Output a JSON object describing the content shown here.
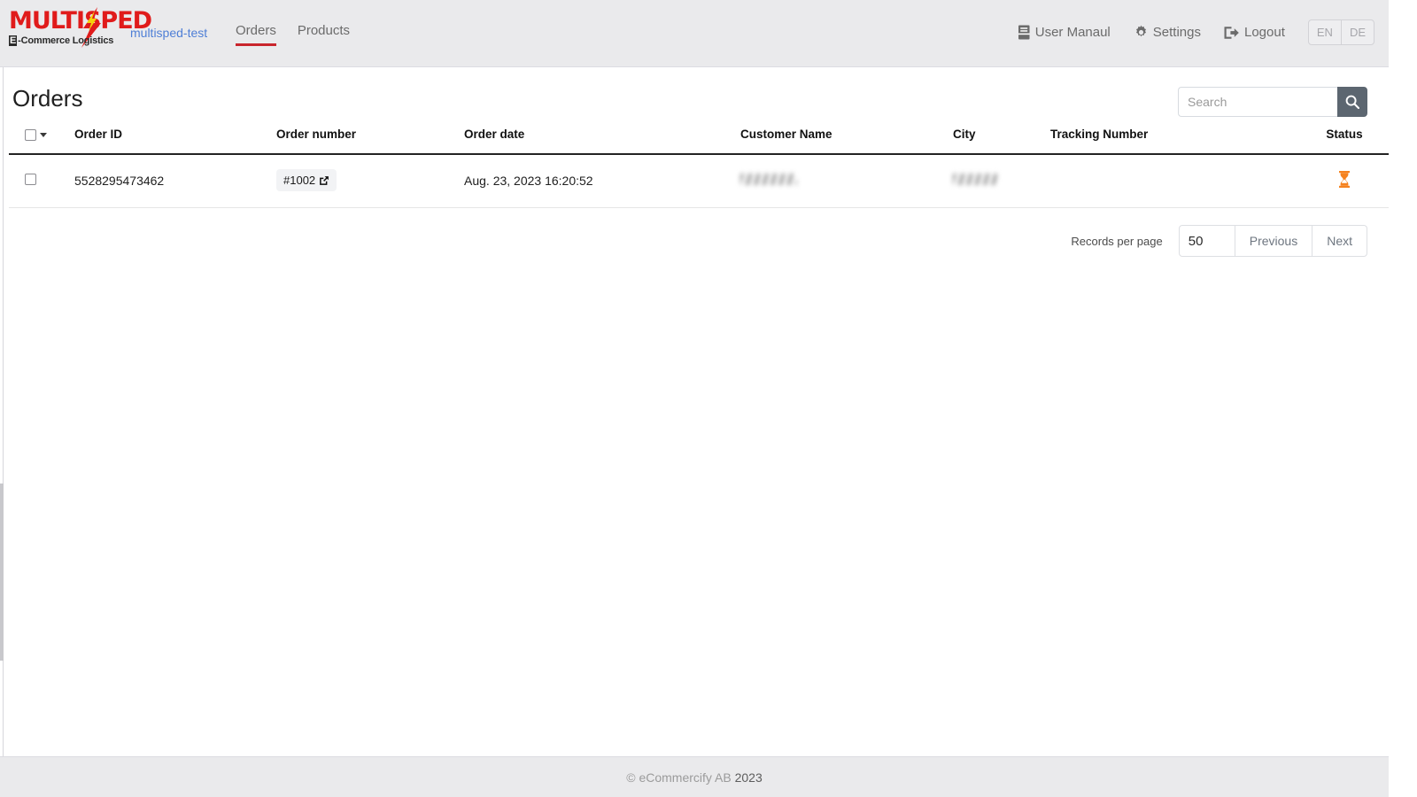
{
  "brand": {
    "logo_word": "MULTISPED",
    "logo_sub_prefix": "E",
    "logo_sub_text": "-Commerce  Logistics",
    "logo_color": "#e01b1b",
    "accent_color": "#c9252c"
  },
  "navbar": {
    "tenant_link": "multisped-test",
    "tabs": [
      {
        "label": "Orders",
        "active": true
      },
      {
        "label": "Products",
        "active": false
      }
    ],
    "actions": [
      {
        "label": "User Manaul",
        "icon": "book-icon"
      },
      {
        "label": "Settings",
        "icon": "gear-icon"
      },
      {
        "label": "Logout",
        "icon": "sign-out-icon"
      }
    ],
    "languages": [
      {
        "code": "EN",
        "selected": false
      },
      {
        "code": "DE",
        "selected": false
      }
    ]
  },
  "page": {
    "title": "Orders"
  },
  "search": {
    "value": "",
    "placeholder": "Search",
    "icon": "search-icon",
    "button_color": "#5c6670"
  },
  "table": {
    "columns": [
      {
        "key": "check",
        "label": ""
      },
      {
        "key": "order_id",
        "label": "Order ID"
      },
      {
        "key": "order_number",
        "label": "Order number"
      },
      {
        "key": "order_date",
        "label": "Order date"
      },
      {
        "key": "customer_name",
        "label": "Customer Name"
      },
      {
        "key": "city",
        "label": "City"
      },
      {
        "key": "tracking_number",
        "label": "Tracking Number"
      },
      {
        "key": "status",
        "label": "Status"
      }
    ],
    "rows": [
      {
        "order_id": "5528295473462",
        "order_number": "#1002",
        "order_number_icon": "external-link-icon",
        "order_date": "Aug. 23, 2023 16:20:52",
        "customer_name": "",
        "customer_name_redacted": true,
        "city": "",
        "city_redacted": true,
        "tracking_number": "",
        "status_icon": "hourglass-icon",
        "status_color": "#f5821f"
      }
    ]
  },
  "pagination": {
    "records_label": "Records per page",
    "records_value": "50",
    "previous_label": "Previous",
    "next_label": "Next"
  },
  "footer": {
    "symbol": "©",
    "company": "eCommercify AB",
    "year": "2023"
  }
}
